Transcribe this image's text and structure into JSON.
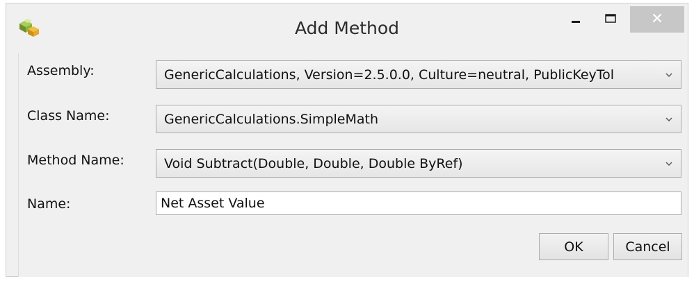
{
  "window": {
    "title": "Add Method",
    "icon": "stacked-boxes-app-icon",
    "controls": {
      "minimize_icon": "minimize-icon",
      "maximize_icon": "maximize-icon",
      "close_icon": "close-icon"
    }
  },
  "form": {
    "assembly": {
      "label": "Assembly:",
      "value": "GenericCalculations, Version=2.5.0.0, Culture=neutral, PublicKeyTol"
    },
    "class_name": {
      "label": "Class Name:",
      "value": "GenericCalculations.SimpleMath"
    },
    "method_name": {
      "label": "Method Name:",
      "value": "Void Subtract(Double, Double, Double ByRef)"
    },
    "name": {
      "label": "Name:",
      "value": "Net Asset Value"
    }
  },
  "buttons": {
    "ok_label": "OK",
    "cancel_label": "Cancel"
  },
  "colors": {
    "window_bg": "#f0f0f0",
    "close_button_bg": "#c7c7c7",
    "border": "#acacac"
  }
}
